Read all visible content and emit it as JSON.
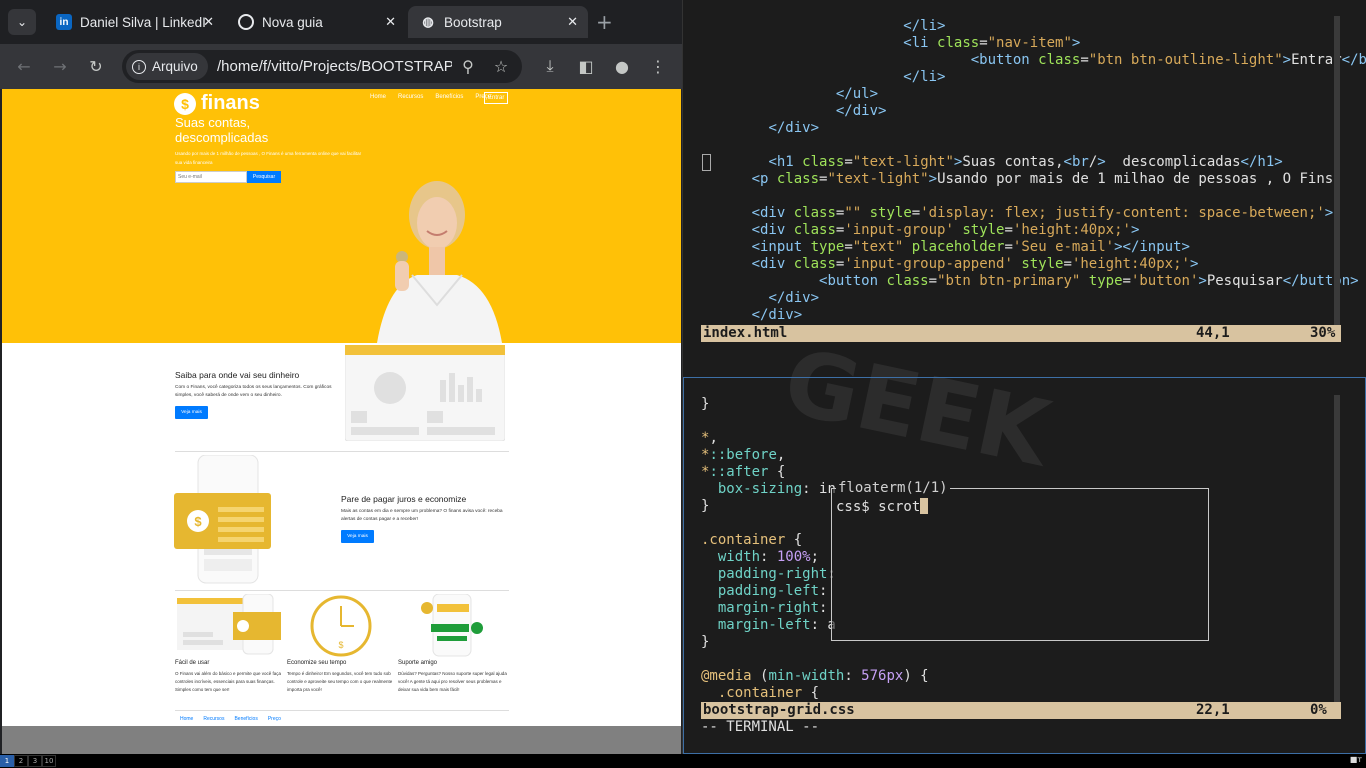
{
  "browser": {
    "tabs": [
      {
        "title": "Daniel Silva | LinkedIn",
        "favicon": "linkedin-icon",
        "active": false
      },
      {
        "title": "Nova guia",
        "favicon": "chrome-icon",
        "active": false
      },
      {
        "title": "Bootstrap",
        "favicon": "globe-icon",
        "active": true
      }
    ],
    "security_chip": "Arquivo",
    "url": "/home/f/vitto/Projects/BOOTSTRAP"
  },
  "webpage": {
    "logo": "finans",
    "nav": [
      "Home",
      "Recursos",
      "Benefícios",
      "Preço"
    ],
    "nav_button": "Entrar",
    "hero_title": "Suas contas, descomplicadas",
    "hero_text": "Usando por mais de 1 milhão de pessoas , O Finans é uma ferramenta online que vai facilitar sua vida financeira",
    "email_placeholder": "Seu e-mail",
    "search_button": "Pesquisar",
    "section1": {
      "title": "Saiba para onde vai seu dinheiro",
      "text": "Com o Finans, você categoriza todos os seus lançamentos. Com gráficos simples, você saberá de onde vem o seu dinheiro.",
      "button": "Veja mais"
    },
    "section2": {
      "title": "Pare de pagar juros e economize",
      "text": "Mais as contas em dia e sempre um problema? O finans avisa você: receba alertas de contas pagar e a receber!",
      "button": "Veja mais"
    },
    "features": [
      {
        "title": "Fácil de usar",
        "text": "O Finans vai além do básico e permite que você faça controles incríveis, essenciais para suas finanças. Simples como tem que ser!"
      },
      {
        "title": "Economize seu tempo",
        "text": "Tempo é dinheiro! Em segundos, você tem tudo sob controle e aproveite seu tempo com o que realmente importa pra você!"
      },
      {
        "title": "Suporte amigo",
        "text": "Dúvidas? Perguntas? Nosso suporte super legal ajuda você! A gente tá aqui pro resolver seus problemas e deixar sua vida bem mais fácil!"
      }
    ],
    "footer_nav": [
      "Home",
      "Recursos",
      "Benefícios",
      "Preço"
    ]
  },
  "vim": {
    "top_pane": {
      "lines": [
        {
          "indent": "            ",
          "html": "</li>"
        },
        {
          "indent": "            ",
          "html": "<li class=\"nav-item\">"
        },
        {
          "indent": "                ",
          "html": "<button class=\"btn btn-outline-light\">Entrar</button>"
        },
        {
          "indent": "            ",
          "html": "</li>"
        },
        {
          "indent": "        ",
          "html": "</ul>"
        },
        {
          "indent": "        ",
          "html": "</div>"
        },
        {
          "indent": "    ",
          "html": "</div>"
        },
        {
          "indent": "",
          "html": ""
        },
        {
          "indent": "    ",
          "html": "<h1 class=\"text-light\">Suas contas,<br/>  descomplicadas</h1>"
        },
        {
          "indent": "   ",
          "html": "<p class=\"text-light\">Usando por mais de 1 milhao de pessoas , O Fins"
        },
        {
          "indent": "",
          "html": ""
        },
        {
          "indent": "   ",
          "html": "<div class=\"\" style='display: flex; justify-content: space-between;'>"
        },
        {
          "indent": "   ",
          "html": "<div class='input-group' style='height:40px;'>"
        },
        {
          "indent": "   ",
          "html": "<input type=\"text\" placeholder='Seu e-mail'></input>"
        },
        {
          "indent": "   ",
          "html": "<div class='input-group-append' style='height:40px;'>"
        },
        {
          "indent": "       ",
          "html": "<button class=\"btn btn-primary\" type='button'>Pesquisar</button>"
        },
        {
          "indent": "    ",
          "html": "</div>"
        },
        {
          "indent": "   ",
          "html": "</div>"
        }
      ],
      "status": {
        "file": "index.html",
        "pos": "44,1",
        "pct": "30%"
      }
    },
    "bottom_pane": {
      "status": {
        "file": "bootstrap-grid.css",
        "pos": "22,1",
        "pct": "0%"
      },
      "mode": "-- TERMINAL --"
    },
    "floaterm": {
      "title": "floaterm(1/1)",
      "prompt": "css$ scrot"
    }
  },
  "taskbar": {
    "workspaces": [
      "1",
      "2",
      "3",
      "10"
    ],
    "tray": "■ᴛ"
  }
}
